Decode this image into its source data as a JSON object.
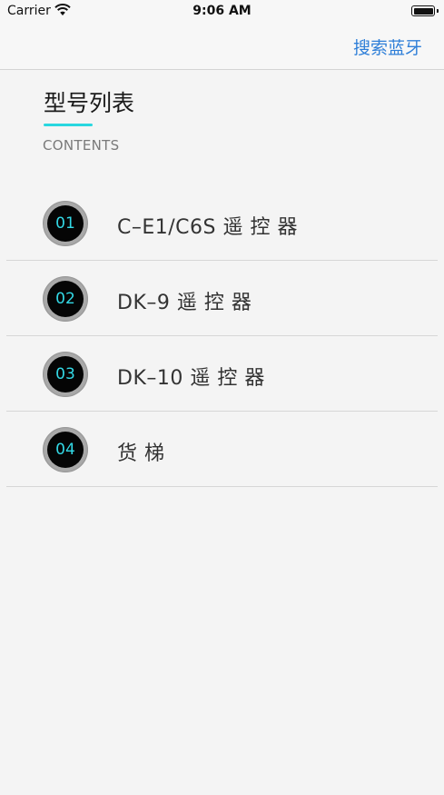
{
  "status": {
    "carrier": "Carrier",
    "time": "9:06 AM"
  },
  "nav": {
    "search_label": "搜索蓝牙"
  },
  "header": {
    "title": "型号列表",
    "subtitle": "CONTENTS"
  },
  "items": [
    {
      "number": "01",
      "label": "C–E1/C6S 遥 控 器"
    },
    {
      "number": "02",
      "label": "DK–9 遥 控 器"
    },
    {
      "number": "03",
      "label": "DK–10 遥 控 器"
    },
    {
      "number": "04",
      "label": "货 梯"
    }
  ],
  "colors": {
    "accent": "#29d7df",
    "link": "#2f7fd8",
    "badge_text": "#33d9e6"
  }
}
